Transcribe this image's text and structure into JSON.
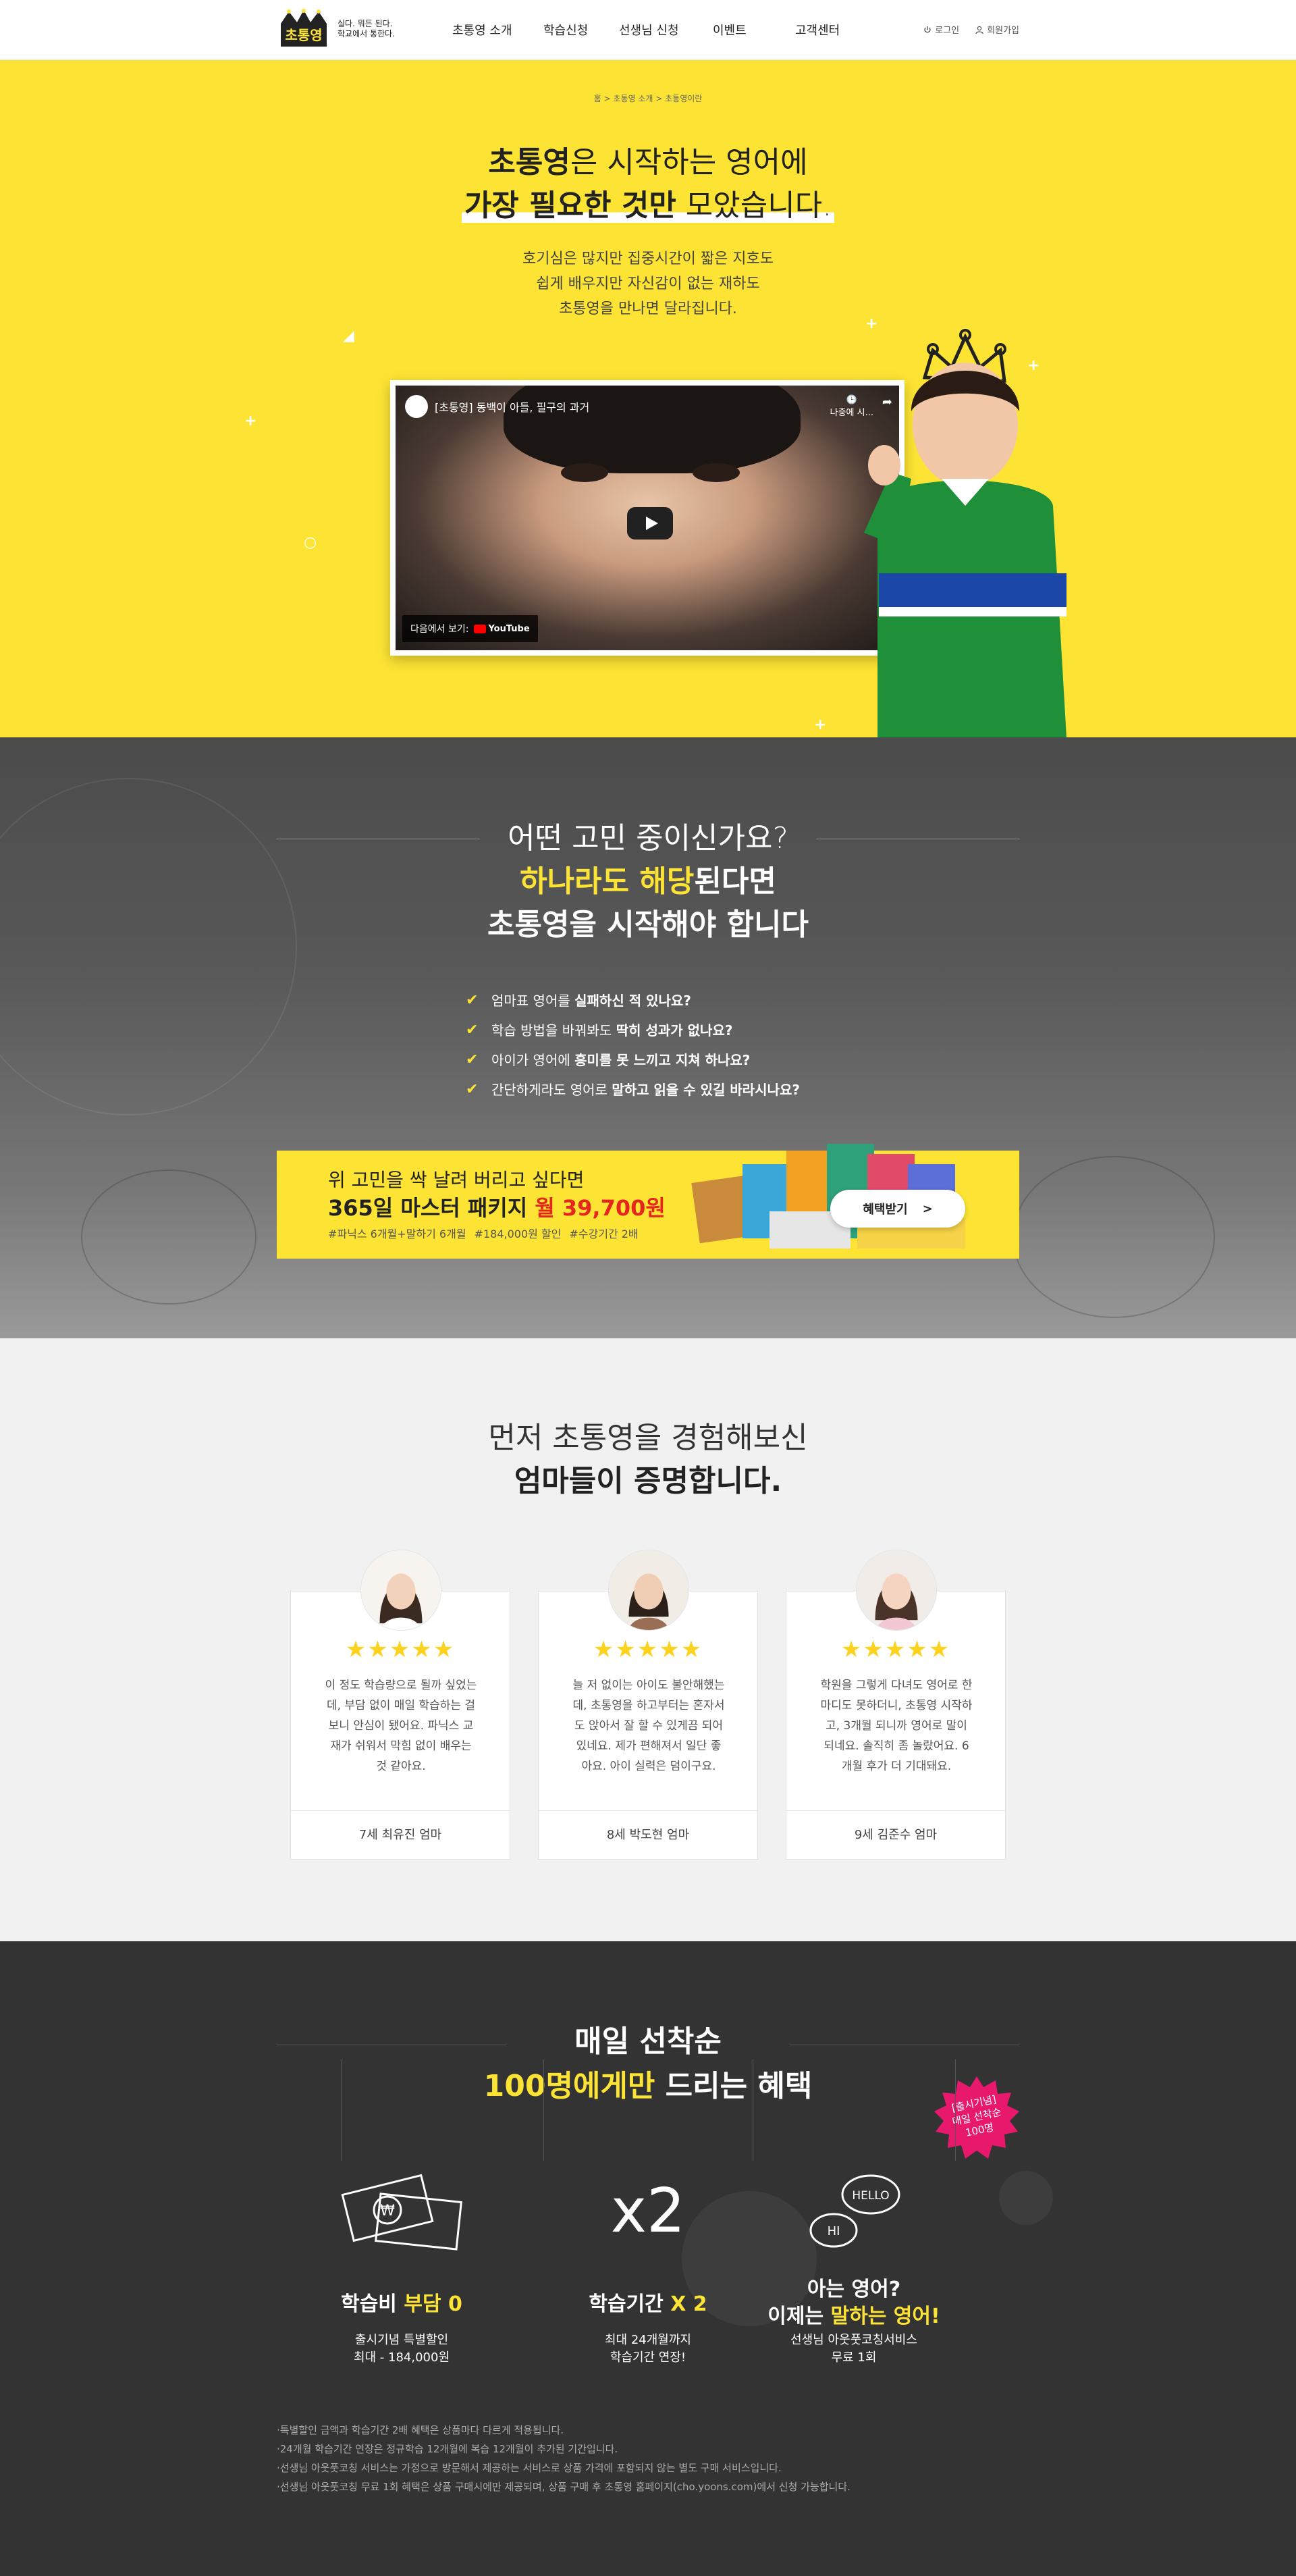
{
  "header": {
    "logo_text": "초통영",
    "logo_tagline": [
      "실다. 뭐든 된다.",
      "학교에서 통한다."
    ],
    "nav": [
      "초통영 소개",
      "학습신청",
      "선생님 신청",
      "이벤트",
      "고객센터"
    ],
    "login": "로그인",
    "signup": "회원가입"
  },
  "hero": {
    "breadcrumb": [
      "홈",
      "초통영 소개",
      "초통영이란"
    ],
    "title_line1_bold": "초통영",
    "title_line1_rest": "은 시작하는 영어에",
    "title_line2_bold": "가장 필요한 것만",
    "title_line2_rest": " 모았습니다.",
    "desc": [
      "호기심은 많지만 집중시간이 짧은 지호도",
      "쉽게 배우지만 자신감이 없는 재하도",
      "초통영을 만나면 달라집니다."
    ],
    "video": {
      "title": "[초통영] 동백이 아들, 필구의 과거",
      "watch_later": "나중에 시...",
      "watch_on": "다음에서 보기:",
      "youtube": "YouTube"
    }
  },
  "problems": {
    "title_line1": "어떤 고민 중이신가요?",
    "title_line2_hl": "하나라도 해당",
    "title_line2_rest": "된다면",
    "title_line3": "초통영을 시작해야 합니다",
    "items": [
      {
        "normal": "엄마표 영어를 ",
        "bold": "실패하신 적 있나요?"
      },
      {
        "normal": "학습 방법을 바꿔봐도 ",
        "bold": "딱히 성과가 없나요?"
      },
      {
        "normal": "아이가 영어에 ",
        "bold": "흥미를 못 느끼고 지쳐 하나요?"
      },
      {
        "normal": "간단하게라도 영어로 ",
        "bold": "말하고 읽을 수 있길 바라시나요?"
      }
    ],
    "promo": {
      "line1": "위 고민을 싹 날려 버리고 싶다면",
      "line2_pre": "365일 마스터 패키지 ",
      "line2_price": "월 39,700원",
      "tags": [
        "#파닉스 6개월+말하기 6개월",
        "#184,000원 할인",
        "#수강기간 2배"
      ],
      "button": "혜택받기"
    }
  },
  "reviews": {
    "title_line1": "먼저 초통영을 경험해보신",
    "title_line2": "엄마들이 증명합니다.",
    "stars": "★★★★★",
    "cards": [
      {
        "text": "이 정도 학습량으로 될까 싶었는데, 부담 없이 매일 학습하는 걸보니 안심이 됐어요. 파닉스 교재가 쉬워서 막힘 없이 배우는 것 같아요.",
        "author": "7세 최유진 엄마"
      },
      {
        "text": "늘 저 없이는 아이도 불안해했는데, 초통영을 하고부터는 혼자서도 앉아서 잘 할 수 있게끔 되어있네요. 제가 편해져서 일단 좋아요. 아이 실력은 덤이구요.",
        "author": "8세 박도현 엄마"
      },
      {
        "text": "학원을 그렇게 다녀도 영어로 한마디도 못하더니, 초통영 시작하고, 3개월 되니까 영어로 말이 되네요. 솔직히 좀 놀랐어요. 6개월 후가 더 기대돼요.",
        "author": "9세 김준수 엄마"
      }
    ]
  },
  "event": {
    "title_line1": "매일 선착순",
    "title_line2_hl": "100명에게만",
    "title_line2_rest": " 드리는 혜택",
    "stamp": [
      "[출시기념]",
      "매일 선착순",
      "100명"
    ],
    "x2_label": "x2",
    "bubble_hello": "HELLO",
    "bubble_hi": "HI",
    "benefits": [
      {
        "title_pre": "학습비 ",
        "title_hl": "부담 0",
        "title_post": "",
        "desc": [
          "출시기념 특별할인",
          "최대 - 184,000원"
        ]
      },
      {
        "title_pre": "학습기간 ",
        "title_hl": "X 2",
        "title_post": "",
        "desc": [
          "최대 24개월까지",
          "학습기간 연장!"
        ]
      },
      {
        "title_pre": "아는 영어?",
        "title_line2_pre": "이제는 ",
        "title_hl": "말하는 영어!",
        "desc": [
          "선생님 아웃풋코칭서비스",
          "무료 1회"
        ]
      }
    ],
    "notes": [
      "·특별할인 금액과 학습기간 2배 혜택은 상품마다 다르게 적용됩니다.",
      "·24개월 학습기간 연장은 정규학습 12개월에 복습 12개월이 추가된 기간입니다.",
      "·선생님 아웃풋코칭 서비스는 가정으로 방문해서 제공하는 서비스로 상품 가격에 포함되지 않는 별도 구매 서비스입니다.",
      "·선생님 아웃풋코칭 무료 1회 혜택은 상품 구매시에만 제공되며, 상품 구매 후 초통영 홈페이지(cho.yoons.com)에서 신청 가능합니다."
    ]
  },
  "colors": {
    "brand_yellow": "#fde434",
    "accent_red": "#e6251d",
    "dark": "#333333",
    "stamp_pink": "#e8186d"
  }
}
